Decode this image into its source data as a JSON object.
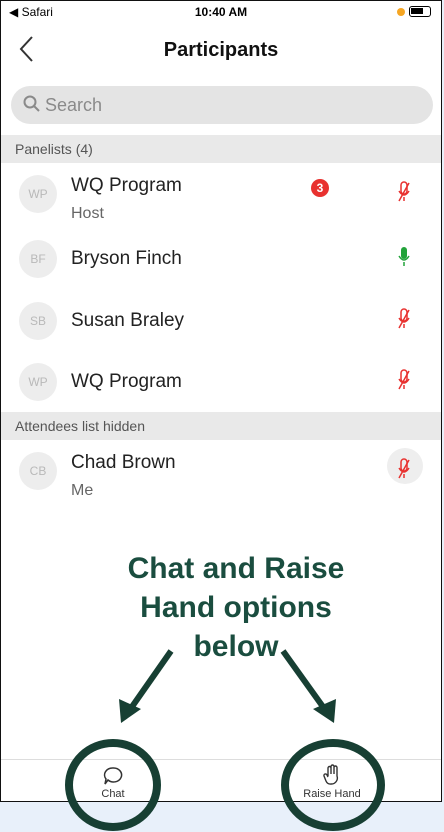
{
  "status": {
    "carrier": "◀ Safari",
    "time": "10:40 AM"
  },
  "nav": {
    "title": "Participants"
  },
  "search": {
    "placeholder": "Search"
  },
  "panelists": {
    "header": "Panelists (4)",
    "items": [
      {
        "initials": "WP",
        "name": "WQ Program",
        "role": "Host",
        "badge": "3",
        "mic": "muted"
      },
      {
        "initials": "BF",
        "name": "Bryson Finch",
        "role": "",
        "mic": "active"
      },
      {
        "initials": "SB",
        "name": "Susan Braley",
        "role": "",
        "mic": "muted"
      },
      {
        "initials": "WP",
        "name": "WQ Program",
        "role": "",
        "mic": "muted"
      }
    ]
  },
  "attendees": {
    "header": "Attendees list hidden",
    "items": [
      {
        "initials": "CB",
        "name": "Chad Brown",
        "role": "Me",
        "mic": "muted"
      }
    ]
  },
  "annotation": {
    "text": "Chat and Raise Hand options below"
  },
  "tabbar": {
    "chat_label": "Chat",
    "raise_hand_label": "Raise Hand"
  },
  "colors": {
    "muted": "#e8312f",
    "active": "#22a33a",
    "annotation": "#173f33"
  }
}
